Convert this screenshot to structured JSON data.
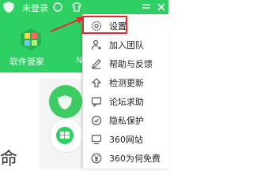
{
  "titlebar": {
    "login_status": "未登录"
  },
  "main": {
    "tile_label": "软件管家",
    "second_label": "N"
  },
  "menu": {
    "items": [
      {
        "label": "设置",
        "icon": "gear-icon"
      },
      {
        "label": "加入团队",
        "icon": "user-add-icon"
      },
      {
        "label": "帮助与反馈",
        "icon": "edit-icon"
      },
      {
        "label": "检测更新",
        "icon": "update-arrow-icon"
      },
      {
        "label": "论坛求助",
        "icon": "forum-icon"
      },
      {
        "label": "隐私保护",
        "icon": "privacy-shield-icon"
      },
      {
        "label": "360网站",
        "icon": "monitor-icon"
      },
      {
        "label": "360为何免费",
        "icon": "yen-icon"
      }
    ]
  },
  "body": {
    "corner_text": "命"
  },
  "colors": {
    "header_green": "#2ecf63",
    "highlight_red": "#e8262b",
    "arrow_red": "#e8262b"
  }
}
